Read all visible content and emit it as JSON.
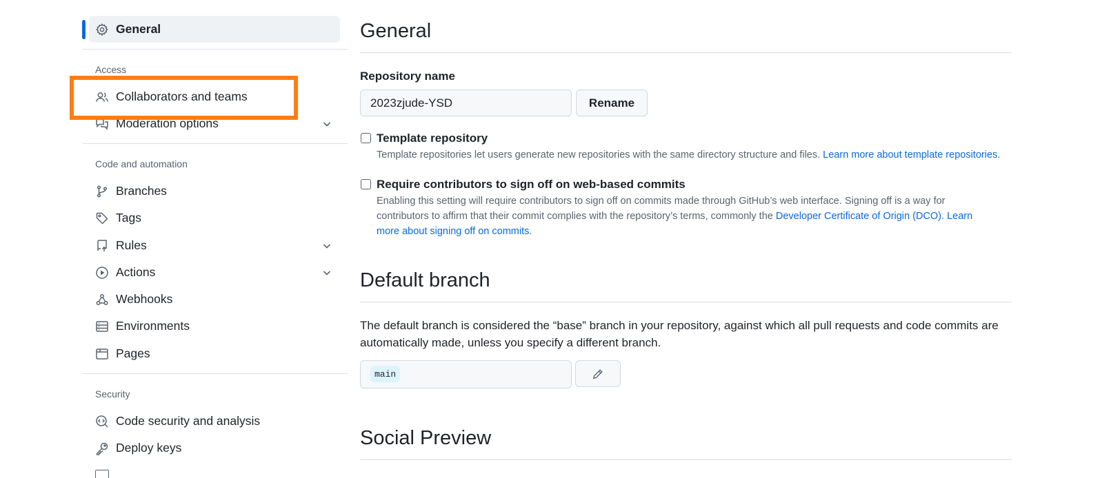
{
  "sidebar": {
    "general": "General",
    "access_heading": "Access",
    "collaborators": "Collaborators and teams",
    "moderation": "Moderation options",
    "code_automation_heading": "Code and automation",
    "branches": "Branches",
    "tags": "Tags",
    "rules": "Rules",
    "actions": "Actions",
    "webhooks": "Webhooks",
    "environments": "Environments",
    "pages": "Pages",
    "security_heading": "Security",
    "code_security": "Code security and analysis",
    "deploy_keys": "Deploy keys"
  },
  "main": {
    "general_title": "General",
    "repo_name_label": "Repository name",
    "repo_name_value": "2023zjude-YSD",
    "rename_button": "Rename",
    "template_title": "Template repository",
    "template_note": "Template repositories let users generate new repositories with the same directory structure and files. ",
    "template_link": "Learn more about template repositories.",
    "signoff_title": "Require contributors to sign off on web-based commits",
    "signoff_note_line1": "Enabling this setting will require contributors to sign off on commits made through GitHub’s web interface. Signing off is a way for",
    "signoff_note_line2_prefix": "contributors to affirm that their commit complies with the repository’s terms, commonly the ",
    "signoff_link_dco": "Developer Certificate of Origin (DCO).",
    "signoff_link_learn_a": " Learn",
    "signoff_link_learn_b": "more about signing off on commits",
    "signoff_period": ".",
    "default_branch_title": "Default branch",
    "default_branch_desc_line1": "The default branch is considered the “base” branch in your repository, against which all pull requests and code commits are",
    "default_branch_desc_line2": "automatically made, unless you specify a different branch.",
    "branch_name": "main",
    "social_preview_title": "Social Preview"
  },
  "colors": {
    "accent": "#0969da",
    "highlight": "#fd7e14"
  }
}
